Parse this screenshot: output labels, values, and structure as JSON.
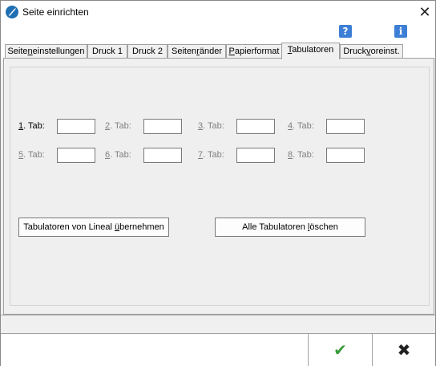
{
  "window": {
    "title": "Seite einrichten",
    "close_glyph": "✕"
  },
  "toolbar": {
    "help_glyph": "?",
    "info_glyph": "i"
  },
  "tabs": [
    {
      "pre": "Seite",
      "u": "n",
      "post": "einstellungen",
      "active": false
    },
    {
      "pre": "Druck 1",
      "u": "",
      "post": "",
      "active": false
    },
    {
      "pre": "Druck 2",
      "u": "",
      "post": "",
      "active": false
    },
    {
      "pre": "Seiten",
      "u": "r",
      "post": "änder",
      "active": false
    },
    {
      "pre": "",
      "u": "P",
      "post": "apierformat",
      "active": false
    },
    {
      "pre": "",
      "u": "T",
      "post": "abulatoren",
      "active": true
    },
    {
      "pre": "Druck",
      "u": "v",
      "post": "oreinst.",
      "active": false
    }
  ],
  "tab_fields": [
    {
      "num": "1",
      "rest": ". Tab:",
      "enabled": true,
      "value": ""
    },
    {
      "num": "2",
      "rest": ". Tab:",
      "enabled": false,
      "value": ""
    },
    {
      "num": "3",
      "rest": ". Tab:",
      "enabled": false,
      "value": ""
    },
    {
      "num": "4",
      "rest": ". Tab:",
      "enabled": false,
      "value": ""
    },
    {
      "num": "5",
      "rest": ". Tab:",
      "enabled": false,
      "value": ""
    },
    {
      "num": "6",
      "rest": ". Tab:",
      "enabled": false,
      "value": ""
    },
    {
      "num": "7",
      "rest": ". Tab:",
      "enabled": false,
      "value": ""
    },
    {
      "num": "8",
      "rest": ". Tab:",
      "enabled": false,
      "value": ""
    }
  ],
  "buttons": {
    "from_ruler": {
      "pre": "Tabulatoren von Lineal ",
      "u": "ü",
      "post": "bernehmen"
    },
    "clear_all": {
      "pre": "Alle Tabulatoren ",
      "u": "l",
      "post": "öschen"
    }
  },
  "footer": {
    "ok_glyph": "✔",
    "cancel_glyph": "✖"
  }
}
